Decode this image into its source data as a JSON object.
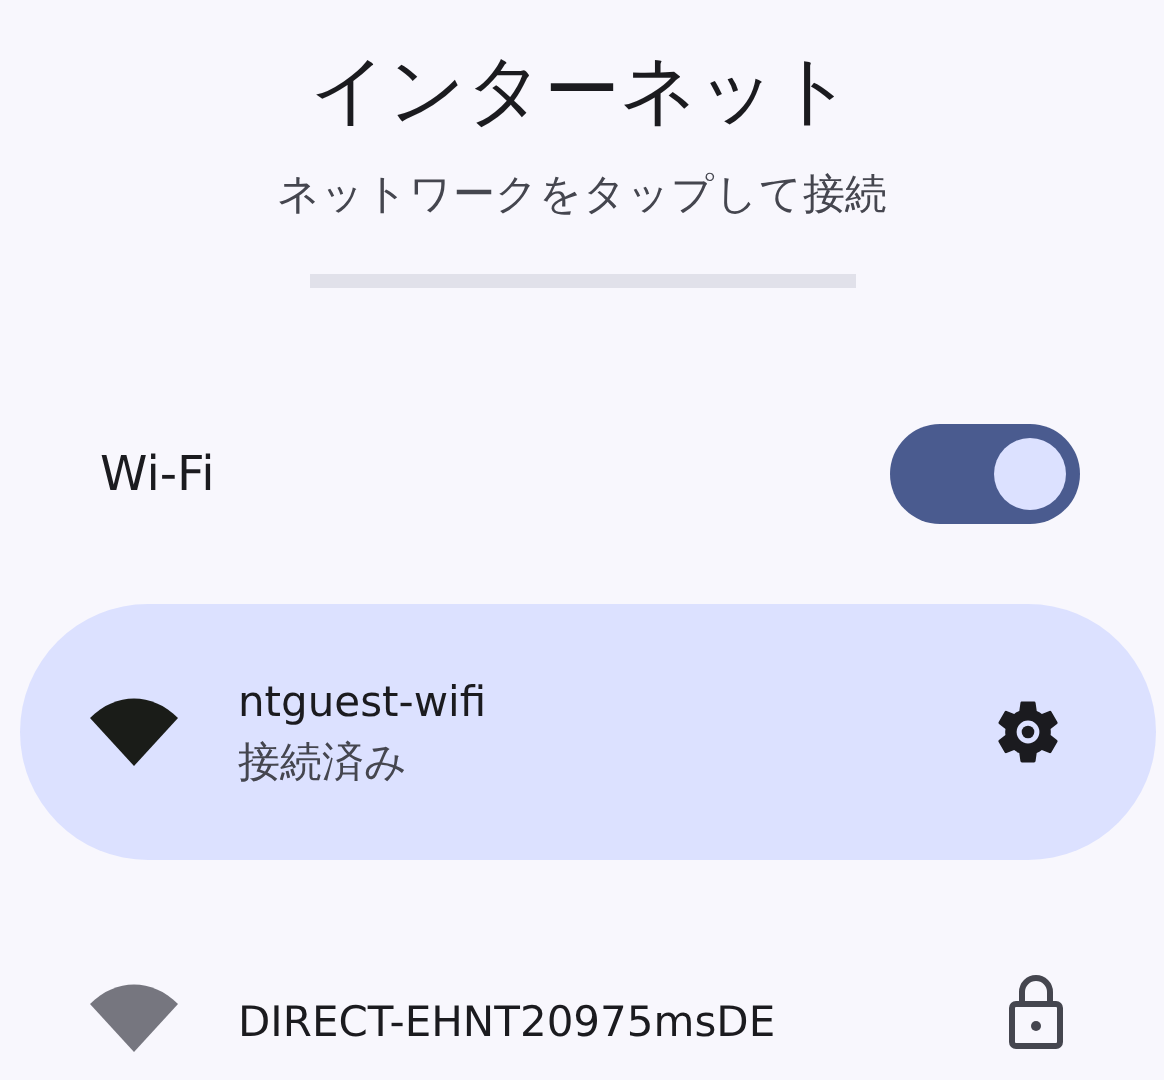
{
  "header": {
    "title": "インターネット",
    "subtitle": "ネットワークをタップして接続"
  },
  "wifi": {
    "label": "Wi-Fi",
    "on": true
  },
  "networks": [
    {
      "name": "ntguest-wifi",
      "status": "接続済み",
      "connected": true,
      "kind": "settings"
    },
    {
      "name": "DIRECT-EHNT20975msDE",
      "connected": false,
      "kind": "lock"
    }
  ]
}
